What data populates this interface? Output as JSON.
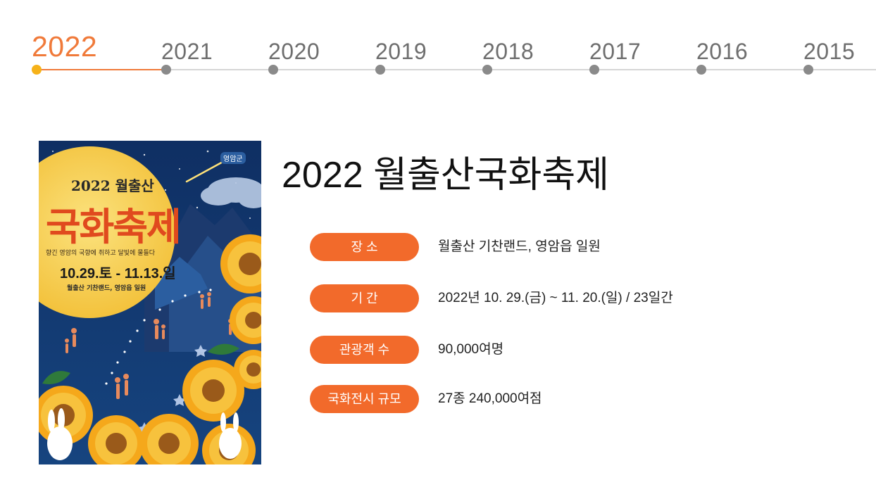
{
  "timeline": {
    "years": [
      {
        "label": "2022",
        "active": true
      },
      {
        "label": "2021",
        "active": false
      },
      {
        "label": "2020",
        "active": false
      },
      {
        "label": "2019",
        "active": false
      },
      {
        "label": "2018",
        "active": false
      },
      {
        "label": "2017",
        "active": false
      },
      {
        "label": "2016",
        "active": false
      },
      {
        "label": "2015",
        "active": false
      }
    ]
  },
  "poster": {
    "brand": "영암군",
    "small_title": "2022 월출산",
    "big_title": "국화축제",
    "slogan": "향긴 영암의 국향에 취하고 달빛에 물들다",
    "dates": "10.29.토 - 11.13.일",
    "place": "월출산 기찬랜드, 영암읍 일원"
  },
  "event": {
    "title": "2022 월출산국화축제"
  },
  "details": [
    {
      "label": "장 소",
      "value": "월출산 기찬랜드, 영암읍 일원"
    },
    {
      "label": "기 간",
      "value": "2022년 10. 29.(금) ~ 11. 20.(일) / 23일간"
    },
    {
      "label": "관광객 수",
      "value": "90,000여명"
    },
    {
      "label": "국화전시 규모",
      "value": "27종 240,000여점"
    }
  ],
  "colors": {
    "accent": "#f07a3a",
    "badge": "#f26a2b",
    "active_dot": "#f6b21a",
    "inactive_dot": "#8a8a8a",
    "poster_sky": "#123a73",
    "poster_moon": "#f8d25a"
  }
}
